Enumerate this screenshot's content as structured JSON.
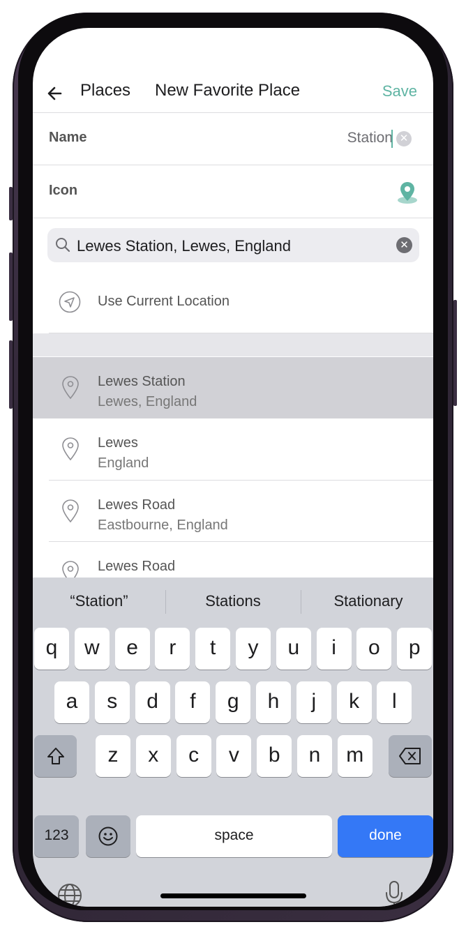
{
  "nav": {
    "back": "back-arrow",
    "places": "Places",
    "title": "New Favorite Place",
    "save": "Save"
  },
  "form": {
    "name_label": "Name",
    "name_value": "Station",
    "icon_label": "Icon"
  },
  "search": {
    "query": "Lewes Station, Lewes, England"
  },
  "current_location": {
    "label": "Use Current Location"
  },
  "results": [
    {
      "primary": "Lewes Station",
      "secondary": "Lewes, England",
      "selected": true
    },
    {
      "primary": "Lewes",
      "secondary": "England",
      "selected": false
    },
    {
      "primary": "Lewes Road",
      "secondary": "Eastbourne, England",
      "selected": false
    },
    {
      "primary": "Lewes Road",
      "secondary": "",
      "selected": false
    }
  ],
  "keyboard": {
    "suggestions": [
      "“Station”",
      "Stations",
      "Stationary"
    ],
    "row1": [
      "q",
      "w",
      "e",
      "r",
      "t",
      "y",
      "u",
      "i",
      "o",
      "p"
    ],
    "row2": [
      "a",
      "s",
      "d",
      "f",
      "g",
      "h",
      "j",
      "k",
      "l"
    ],
    "row3": [
      "z",
      "x",
      "c",
      "v",
      "b",
      "n",
      "m"
    ],
    "numbers_label": "123",
    "space_label": "space",
    "done_label": "done"
  },
  "colors": {
    "accent": "#5fb4a3",
    "done_key": "#3478f6"
  }
}
